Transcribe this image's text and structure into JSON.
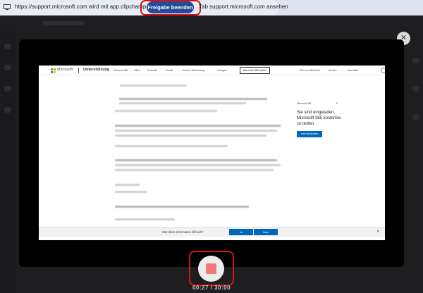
{
  "share_bar": {
    "message": "https://support.microsoft.com wird mit app.clipchamp.com geteilt",
    "stop_label": "Freigabe beenden",
    "view_tab_label": "Tab support.microsoft.com ansehen"
  },
  "browser_page": {
    "brand": "Microsoft",
    "section": "Unterstützung",
    "nav": [
      "Microsoft 365",
      "Office",
      "Produkte",
      "Geräte",
      "Konto & Abrechnung",
      "Vorlagen"
    ],
    "buy_label": "Microsoft 365 kaufen",
    "all_microsoft": "Alles von Microsoft",
    "search_label": "Suchen",
    "signin_label": "Anmelden",
    "promo": {
      "logo_text": "Microsoft 365",
      "close": "✕",
      "title": "Sie sind eingeladen, Microsoft 365 kostenlos zu testen",
      "button": "Jetzt freischalten"
    },
    "feedback": {
      "question": "War diese Information hilfreich?",
      "yes": "Ja",
      "no": "Nein",
      "close": "✕"
    }
  },
  "close_glyph": "✕",
  "timer": "00:27 / 30:00",
  "colors": {
    "accent": "#264b96",
    "highlight": "#d4121b",
    "ms_blue": "#0067b8",
    "record_stop": "#f27a7a"
  }
}
